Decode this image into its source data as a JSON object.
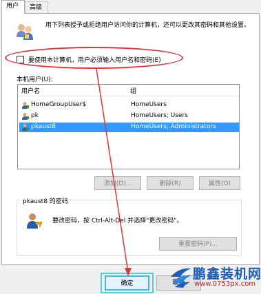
{
  "tabs": [
    {
      "label": "用户"
    },
    {
      "label": "高级"
    }
  ],
  "intro_text": "用下列表授予或拒绝用户访问你的计算机，还可以更改其密码和其他设置。",
  "require_login_checkbox": {
    "label": "要使用本计算机，用户必须输入用户名和密码(E)",
    "checked": false
  },
  "users_group_label": "本机用户(U):",
  "users_table": {
    "columns": [
      "用户名",
      "组"
    ],
    "rows": [
      {
        "name": "HomeGroupUser$",
        "group": "HomeUsers",
        "selected": false
      },
      {
        "name": "pk",
        "group": "HomeUsers; Users",
        "selected": false
      },
      {
        "name": "pkaust8",
        "group": "HomeUsers; Administrators",
        "selected": true
      }
    ]
  },
  "buttons": {
    "add": "添加(D)...",
    "remove": "删除(R)",
    "properties": "属性(O)",
    "reset_password": "重置密码(P)...",
    "ok": "确定",
    "cancel": "取消"
  },
  "password_section": {
    "title": "pkaust8 的密码",
    "text": "要改密码，按 Ctrl-Alt-Del 并选择\"更改密码\"。"
  },
  "watermark": {
    "name": "鹏鑫装机网",
    "url": "www.0753px.com"
  },
  "colors": {
    "highlight_oval": "#e23434",
    "selection": "#3399ff",
    "ok_focus": "#3db9e8",
    "watermark_blue": "#1d5fb8",
    "watermark_red": "#c81e1e"
  }
}
